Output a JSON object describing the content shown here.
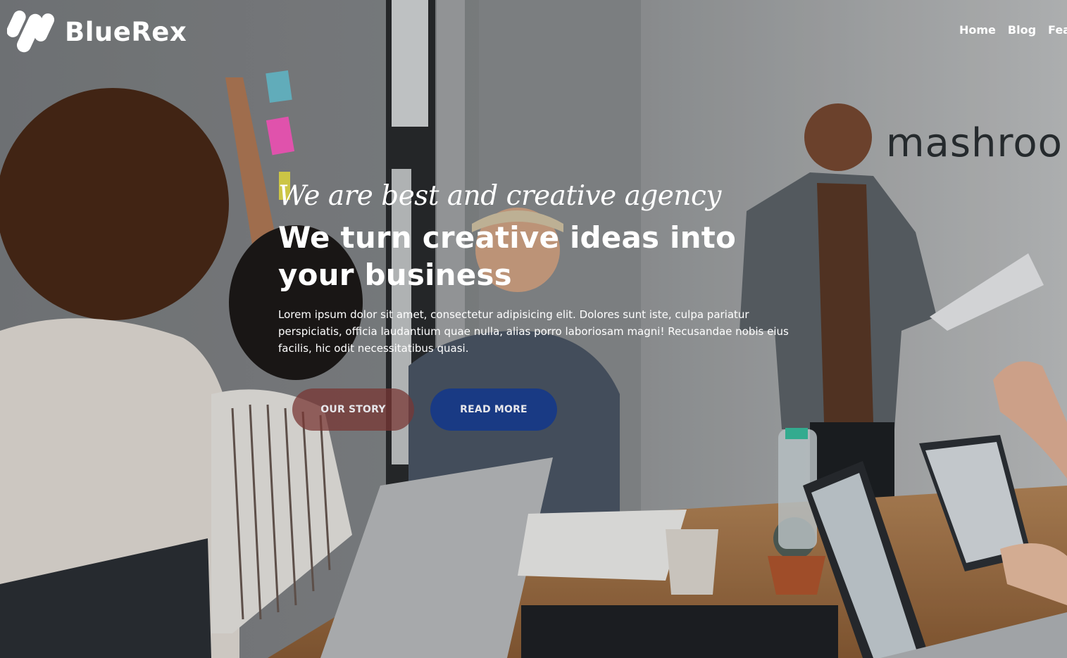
{
  "brand": {
    "name": "BlueRex",
    "logo_icon": "bluerex-logo-icon"
  },
  "nav": {
    "items": [
      {
        "label": "Home"
      },
      {
        "label": "Blog"
      },
      {
        "label": "Fea"
      }
    ]
  },
  "hero": {
    "tagline": "We are best and creative agency",
    "headline": "We turn creative ideas into your business",
    "description": "Lorem ipsum dolor sit amet, consectetur adipisicing elit. Dolores sunt iste, culpa pariatur perspiciatis, officia laudantium quae nulla, alias porro laboriosam magni! Recusandae nobis eius facilis, hic odit necessitatibus quasi.",
    "buttons": {
      "primary": "OUR STORY",
      "secondary": "READ MORE"
    },
    "wall_sign": "mashroo"
  },
  "colors": {
    "our_story_button": "#783734",
    "read_more_button": "#12378c",
    "text": "#ffffff"
  }
}
